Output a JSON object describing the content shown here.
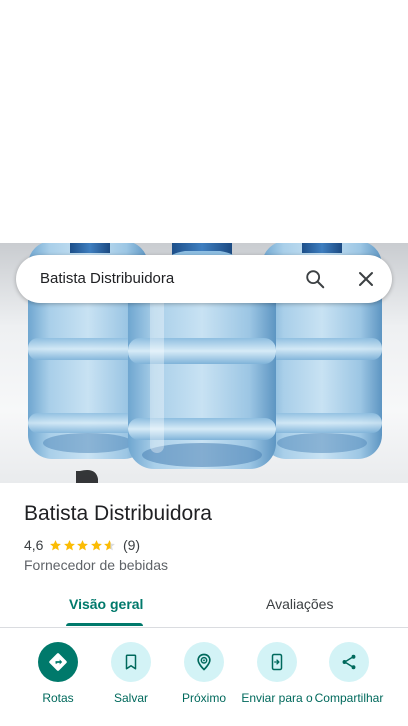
{
  "search": {
    "query": "Batista Distribuidora"
  },
  "icons": {
    "search": "search-icon",
    "close": "close-icon"
  },
  "hero": {
    "image": "water-gallon-bottles-photo"
  },
  "place": {
    "name": "Batista Distribuidora",
    "rating": "4,6",
    "stars_value": 4.6,
    "reviews": "(9)",
    "category": "Fornecedor de bebidas"
  },
  "tabs": [
    {
      "label": "Visão geral",
      "active": true
    },
    {
      "label": "Avaliações",
      "active": false
    }
  ],
  "actions": [
    {
      "label": "Rotas",
      "icon": "directions-icon"
    },
    {
      "label": "Salvar",
      "icon": "bookmark-icon"
    },
    {
      "label": "Próximo",
      "icon": "nearby-icon"
    },
    {
      "label": "Enviar para o",
      "icon": "send-to-phone-icon"
    },
    {
      "label": "Compartilhar",
      "icon": "share-icon"
    }
  ],
  "colors": {
    "accent": "#00796b",
    "star": "#fbbc04",
    "action_bg": "#d3f3f6"
  }
}
